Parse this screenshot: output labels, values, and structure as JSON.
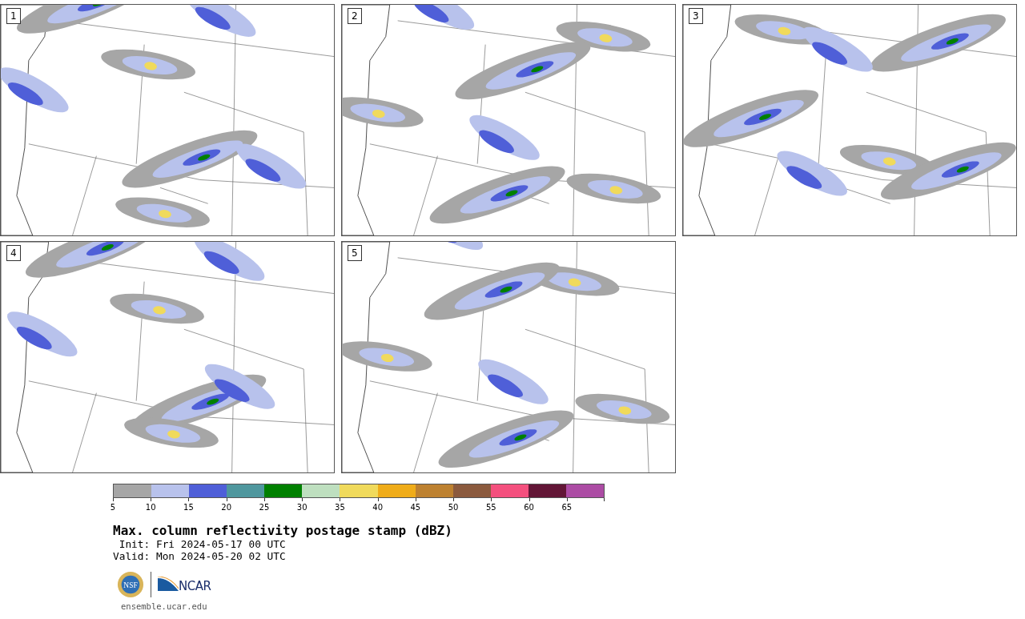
{
  "panels": [
    {
      "number": "1"
    },
    {
      "number": "2"
    },
    {
      "number": "3"
    },
    {
      "number": "4"
    },
    {
      "number": "5"
    }
  ],
  "colorbar": {
    "bins": [
      {
        "label": "5",
        "color": "#a6a6a6"
      },
      {
        "label": "10",
        "color": "#b8c2ec"
      },
      {
        "label": "15",
        "color": "#4f5fd8"
      },
      {
        "label": "20",
        "color": "#4f979e"
      },
      {
        "label": "25",
        "color": "#008000"
      },
      {
        "label": "30",
        "color": "#bedfbf"
      },
      {
        "label": "35",
        "color": "#f0da5c"
      },
      {
        "label": "40",
        "color": "#efac19"
      },
      {
        "label": "45",
        "color": "#bd8130"
      },
      {
        "label": "50",
        "color": "#8b5a3e"
      },
      {
        "label": "55",
        "color": "#f4507e"
      },
      {
        "label": "60",
        "color": "#621636"
      },
      {
        "label": "65",
        "color": "#ac4ca4"
      }
    ]
  },
  "title": "Max. column reflectivity postage stamp (dBZ)",
  "init": " Init: Fri 2024-05-17 00 UTC",
  "valid": "Valid: Mon 2024-05-20 02 UTC",
  "logos": {
    "nsf": "NSF",
    "ncar": "NCAR"
  },
  "site": "ensemble.ucar.edu"
}
